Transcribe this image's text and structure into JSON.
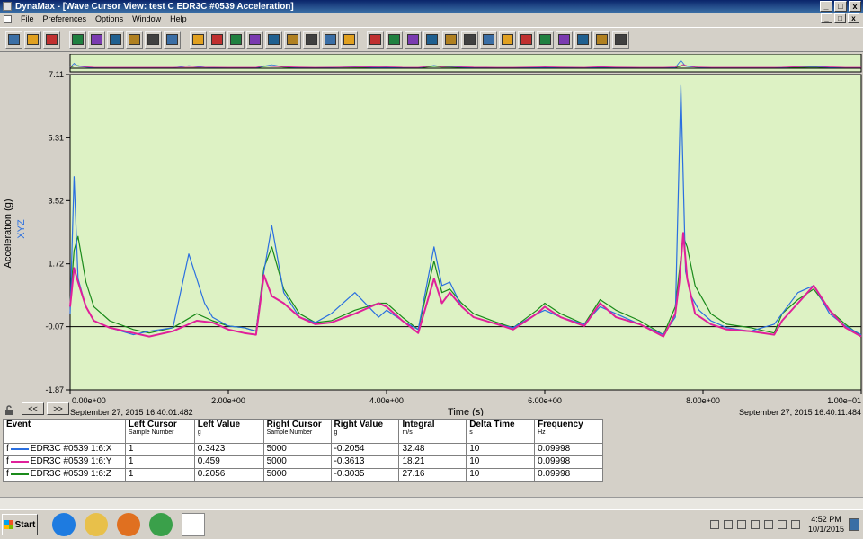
{
  "window": {
    "title": "DynaMax - [Wave Cursor View: test C EDR3C #0539 Acceleration]",
    "btn_min": "_",
    "btn_max": "□",
    "btn_close": "x"
  },
  "menu": [
    "File",
    "Preferences",
    "Options",
    "Window",
    "Help"
  ],
  "toolbar": {
    "icon_count": 32
  },
  "chart_data": {
    "type": "line",
    "ylabel": "Acceleration (g)",
    "ylabel2": "XYZ",
    "xlabel": "Time (s)",
    "y_ticks": [
      7.11,
      5.31,
      3.52,
      1.72,
      -0.07,
      -1.87
    ],
    "y_tick_labels": [
      "7.11",
      "5.31",
      "3.52",
      "1.72",
      "-0.07",
      "-1.87"
    ],
    "x_ticks": [
      0,
      2,
      4,
      6,
      8,
      10
    ],
    "x_tick_labels": [
      "0.00e+00",
      "2.00e+00",
      "4.00e+00",
      "6.00e+00",
      "8.00e+00",
      "1.00e+01"
    ],
    "xlim": [
      0,
      10
    ],
    "ylim": [
      -1.87,
      7.11
    ],
    "zero_line": -0.07,
    "start_time": "September 27, 2015 16:40:01.482",
    "end_time": "September 27, 2015 16:40:11.484",
    "series": [
      {
        "name": "EDR3C #0539 1:6:Z",
        "color": "#1a8a1a",
        "x": [
          0,
          0.05,
          0.1,
          0.2,
          0.3,
          0.5,
          0.8,
          1.0,
          1.3,
          1.6,
          1.8,
          2.0,
          2.2,
          2.35,
          2.45,
          2.55,
          2.7,
          2.9,
          3.1,
          3.3,
          3.6,
          3.9,
          4.0,
          4.2,
          4.4,
          4.6,
          4.7,
          4.8,
          4.95,
          5.1,
          5.4,
          5.6,
          5.9,
          6.0,
          6.2,
          6.5,
          6.7,
          6.9,
          7.2,
          7.5,
          7.65,
          7.7,
          7.75,
          7.8,
          7.9,
          8.1,
          8.3,
          8.6,
          8.9,
          9.0,
          9.2,
          9.4,
          9.6,
          9.8,
          10.0
        ],
        "y": [
          0.6,
          2.1,
          2.5,
          1.2,
          0.5,
          0.1,
          -0.15,
          -0.25,
          -0.1,
          0.3,
          0.1,
          -0.05,
          -0.1,
          -0.2,
          1.6,
          2.2,
          1.0,
          0.3,
          0.05,
          0.1,
          0.4,
          0.6,
          0.6,
          0.2,
          -0.15,
          1.8,
          0.9,
          1.0,
          0.6,
          0.3,
          0.05,
          -0.1,
          0.4,
          0.6,
          0.3,
          0.0,
          0.7,
          0.4,
          0.1,
          -0.3,
          0.5,
          1.5,
          2.5,
          2.2,
          1.1,
          0.3,
          0.0,
          -0.1,
          -0.25,
          0.3,
          0.7,
          1.0,
          0.4,
          0.0,
          -0.35
        ]
      },
      {
        "name": "EDR3C #0539 1:6:X",
        "color": "#2a6fe0",
        "x": [
          0,
          0.05,
          0.1,
          0.2,
          0.3,
          0.5,
          0.8,
          1.0,
          1.3,
          1.5,
          1.7,
          1.8,
          2.0,
          2.2,
          2.35,
          2.45,
          2.55,
          2.7,
          2.9,
          3.1,
          3.3,
          3.6,
          3.9,
          4.0,
          4.2,
          4.4,
          4.6,
          4.7,
          4.8,
          4.95,
          5.1,
          5.4,
          5.6,
          5.9,
          6.0,
          6.2,
          6.5,
          6.7,
          6.9,
          7.2,
          7.5,
          7.65,
          7.72,
          7.78,
          7.85,
          7.95,
          8.1,
          8.3,
          8.6,
          8.9,
          9.0,
          9.2,
          9.4,
          9.6,
          9.8,
          10.0
        ],
        "y": [
          0.3,
          4.2,
          1.3,
          0.5,
          0.1,
          -0.1,
          -0.3,
          -0.2,
          -0.1,
          2.0,
          0.6,
          0.2,
          -0.05,
          -0.1,
          -0.2,
          1.5,
          2.8,
          0.9,
          0.2,
          0.05,
          0.3,
          0.9,
          0.2,
          0.4,
          0.1,
          -0.15,
          2.2,
          1.1,
          1.2,
          0.5,
          0.2,
          0.0,
          -0.1,
          0.3,
          0.4,
          0.2,
          0.0,
          0.5,
          0.3,
          0.0,
          -0.3,
          0.2,
          6.8,
          1.5,
          0.8,
          0.4,
          0.1,
          -0.1,
          -0.2,
          0.0,
          0.3,
          0.9,
          1.1,
          0.3,
          -0.05,
          -0.3
        ]
      },
      {
        "name": "EDR3C #0539 1:6:Y",
        "color": "#e0209a",
        "x": [
          0,
          0.05,
          0.1,
          0.2,
          0.3,
          0.5,
          0.8,
          1.0,
          1.3,
          1.6,
          1.8,
          2.0,
          2.2,
          2.35,
          2.45,
          2.55,
          2.7,
          2.9,
          3.1,
          3.3,
          3.6,
          3.9,
          4.0,
          4.2,
          4.4,
          4.6,
          4.7,
          4.8,
          4.95,
          5.1,
          5.4,
          5.6,
          5.9,
          6.0,
          6.2,
          6.5,
          6.7,
          6.9,
          7.2,
          7.5,
          7.65,
          7.7,
          7.75,
          7.8,
          7.9,
          8.1,
          8.3,
          8.6,
          8.9,
          9.0,
          9.2,
          9.4,
          9.6,
          9.8,
          10.0
        ],
        "y": [
          0.5,
          1.6,
          1.2,
          0.5,
          0.1,
          -0.1,
          -0.25,
          -0.35,
          -0.2,
          0.1,
          0.05,
          -0.15,
          -0.25,
          -0.3,
          1.4,
          0.8,
          0.6,
          0.2,
          0.0,
          0.05,
          0.3,
          0.6,
          0.5,
          0.1,
          -0.25,
          1.3,
          0.6,
          0.9,
          0.5,
          0.2,
          0.0,
          -0.15,
          0.3,
          0.5,
          0.2,
          -0.05,
          0.6,
          0.2,
          0.0,
          -0.35,
          0.3,
          1.2,
          2.6,
          1.3,
          0.3,
          0.0,
          -0.15,
          -0.2,
          -0.3,
          0.1,
          0.6,
          1.1,
          0.4,
          -0.1,
          -0.35
        ]
      }
    ]
  },
  "nav": {
    "prev": "<<",
    "next": ">>"
  },
  "table": {
    "headers": [
      {
        "title": "Event",
        "sub": ""
      },
      {
        "title": "Left Cursor",
        "sub": "Sample Number"
      },
      {
        "title": "Left Value",
        "sub": "g"
      },
      {
        "title": "Right Cursor",
        "sub": "Sample Number"
      },
      {
        "title": "Right Value",
        "sub": "g"
      },
      {
        "title": "Integral",
        "sub": "m/s"
      },
      {
        "title": "Delta Time",
        "sub": "s"
      },
      {
        "title": "Frequency",
        "sub": "Hz"
      }
    ],
    "rows": [
      {
        "flag": "f",
        "color": "#2a6fe0",
        "event": "EDR3C #0539 1:6:X",
        "left_cursor": "1",
        "left_value": "0.3423",
        "right_cursor": "5000",
        "right_value": "-0.2054",
        "integral": "32.48",
        "delta_time": "10",
        "frequency": "0.09998"
      },
      {
        "flag": "f",
        "color": "#e0209a",
        "event": "EDR3C #0539 1:6:Y",
        "left_cursor": "1",
        "left_value": "0.459",
        "right_cursor": "5000",
        "right_value": "-0.3613",
        "integral": "18.21",
        "delta_time": "10",
        "frequency": "0.09998"
      },
      {
        "flag": "f",
        "color": "#1a8a1a",
        "event": "EDR3C #0539 1:6:Z",
        "left_cursor": "1",
        "left_value": "0.2056",
        "right_cursor": "5000",
        "right_value": "-0.3035",
        "integral": "27.16",
        "delta_time": "10",
        "frequency": "0.09998"
      }
    ]
  },
  "taskbar": {
    "start_label": "Start",
    "apps": [
      {
        "name": "internet-explorer",
        "color": "#1e7be0"
      },
      {
        "name": "file-explorer",
        "color": "#e8c04a"
      },
      {
        "name": "media-player",
        "color": "#e07020"
      },
      {
        "name": "chrome",
        "color": "#3aa04a"
      },
      {
        "name": "dynamax",
        "color": "#ffffff"
      }
    ],
    "clock_time": "4:52 PM",
    "clock_date": "10/1/2015"
  }
}
